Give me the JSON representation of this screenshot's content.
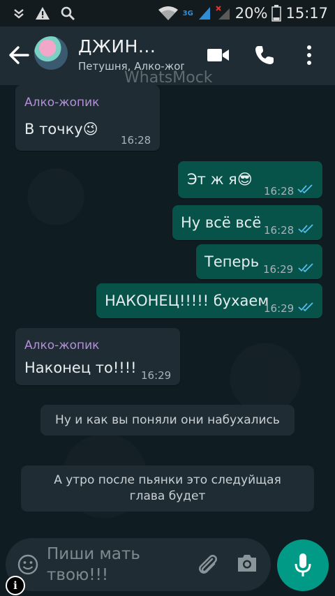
{
  "status_bar": {
    "network_label": "3G",
    "battery_text": "20%",
    "time": "15:17"
  },
  "header": {
    "title": "ДЖИН...",
    "subtitle": "Петушня, Алко-жопик",
    "watermark": "WhatsMock"
  },
  "messages": [
    {
      "direction": "in",
      "sender": "Алко-жопик",
      "text": "В точку",
      "emoji": "😉",
      "time": "16:28"
    },
    {
      "direction": "out",
      "text": "Эт ж я",
      "emoji": "😎",
      "time": "16:28"
    },
    {
      "direction": "out",
      "text": "Ну всё всё",
      "time": "16:28"
    },
    {
      "direction": "out",
      "text": "Теперь",
      "time": "16:29"
    },
    {
      "direction": "out",
      "text": "НАКОНЕЦ!!!!! бухаем",
      "time": "16:29"
    },
    {
      "direction": "in",
      "sender": "Алко-жопик",
      "text": "Наконец то!!!!",
      "time": "16:29"
    }
  ],
  "system_messages": [
    "Ну и как вы поняли они набухались",
    "А утро после пьянки это следуйщая глава будет"
  ],
  "input": {
    "placeholder": "Пиши мать твою!!!"
  },
  "colors": {
    "header_bg": "#1f2c33",
    "incoming_bubble": "#1f2c33",
    "outgoing_bubble": "#07534a",
    "accent": "#009a86",
    "sender_name": "#b58fd9",
    "read_ticks": "#53bdeb"
  },
  "icons": [
    "back-arrow-icon",
    "video-call-icon",
    "phone-icon",
    "more-vert-icon",
    "emoji-icon",
    "attach-icon",
    "camera-icon",
    "mic-icon",
    "info-icon"
  ]
}
